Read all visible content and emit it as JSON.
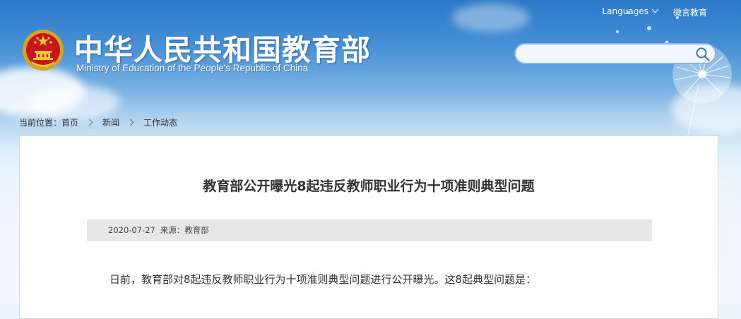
{
  "header": {
    "languages_label": "Languages",
    "weibo_label": "微言教育",
    "site_title": "中华人民共和国教育部",
    "site_subtitle": "Ministry of Education of the People's Republic of China",
    "search_placeholder": ""
  },
  "breadcrumb": {
    "prefix": "当前位置：",
    "items": [
      "首页",
      "新闻",
      "工作动态"
    ]
  },
  "article": {
    "title": "教育部公开曝光8起违反教师职业行为十项准则典型问题",
    "date": "2020-07-27",
    "source": "来源：教育部",
    "intro": "日前，教育部对8起违反教师职业行为十项准则典型问题进行公开曝光。这8起典型问题是："
  },
  "colors": {
    "sky_top": "#2a78c8",
    "panel_bg": "#ffffff",
    "meta_bar_bg": "#e8e8e8",
    "search_border": "#8fb2e6"
  },
  "icons": [
    "national-emblem-icon",
    "search-icon",
    "chevron-down-icon",
    "breadcrumb-separator-icon"
  ]
}
